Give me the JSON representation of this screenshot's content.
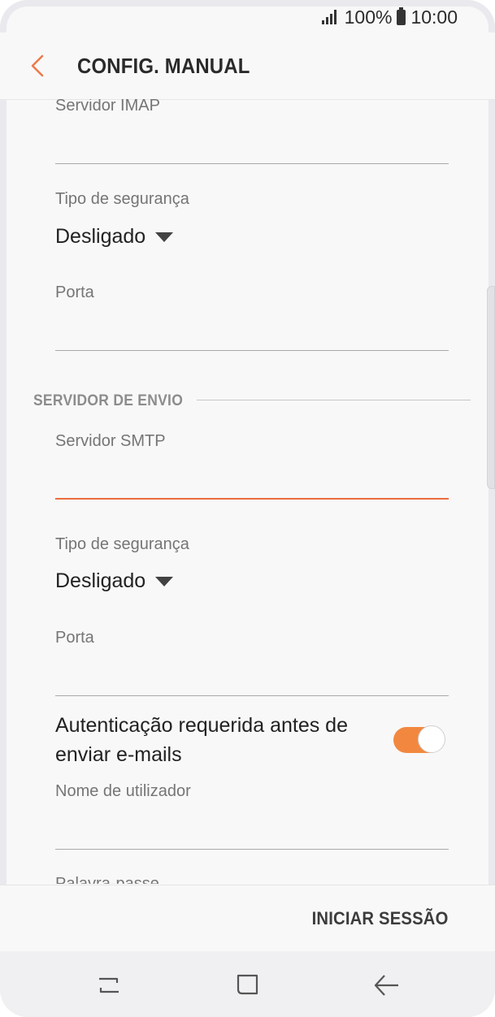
{
  "status": {
    "signal_icon": "signal-icon",
    "battery": "100%",
    "battery_icon": "battery-icon",
    "time": "10:00"
  },
  "header": {
    "title": "CONFIG. MANUAL"
  },
  "incoming": {
    "server_label": "Servidor IMAP",
    "server_value": "",
    "security_label": "Tipo de segurança",
    "security_value": "Desligado",
    "port_label": "Porta",
    "port_value": ""
  },
  "outgoing": {
    "section_title": "SERVIDOR DE ENVIO",
    "server_label": "Servidor SMTP",
    "server_value": "",
    "security_label": "Tipo de segurança",
    "security_value": "Desligado",
    "port_label": "Porta",
    "port_value": "",
    "auth_label": "Autenticação requerida antes de enviar e-mails",
    "auth_enabled": true,
    "username_label": "Nome de utilizador",
    "username_value": "",
    "password_label": "Palavra-passe"
  },
  "footer": {
    "action_label": "INICIAR SESSÃO"
  },
  "colors": {
    "accent": "#ee6c3f",
    "toggle_on": "#f2883f"
  }
}
